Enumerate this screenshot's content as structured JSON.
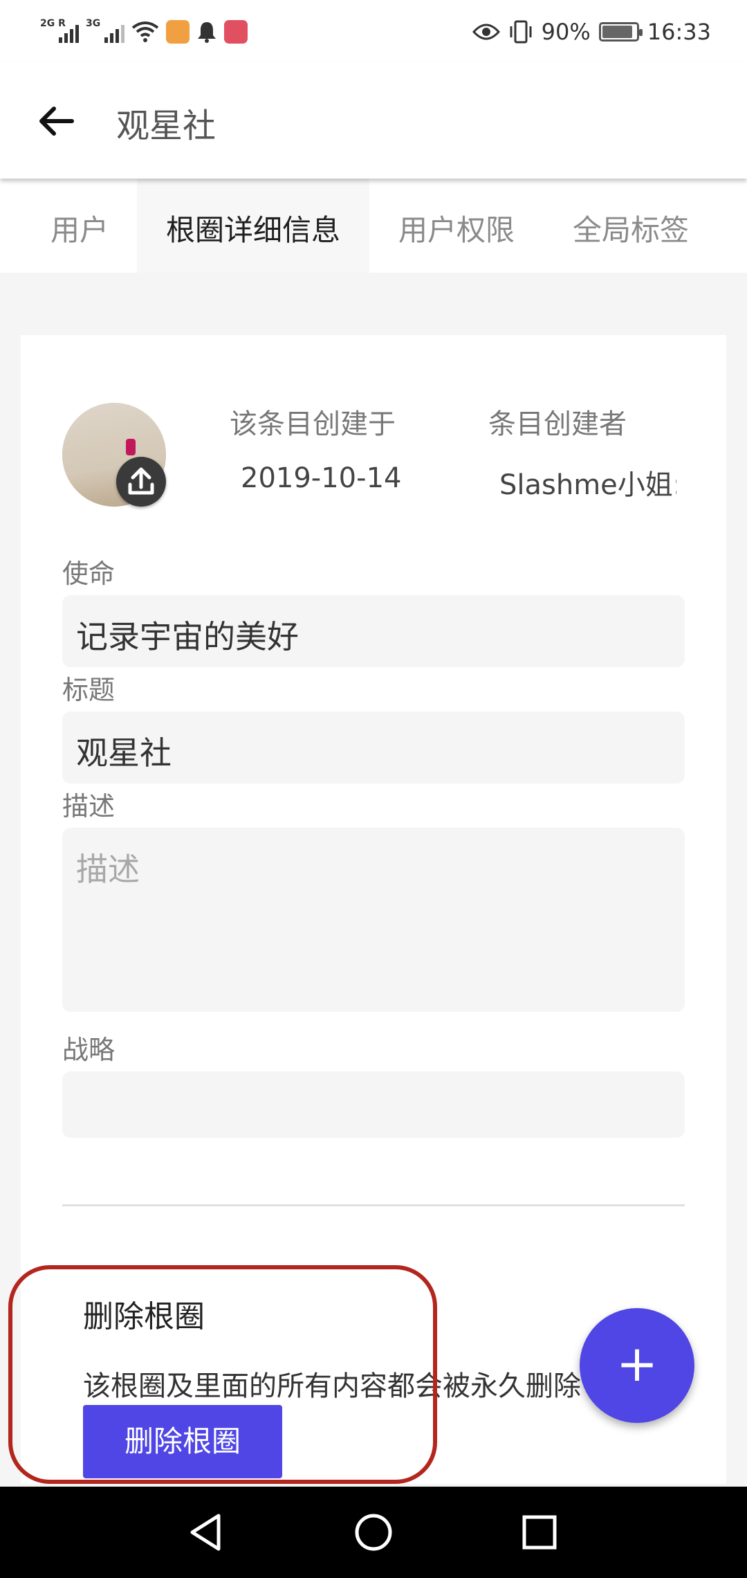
{
  "status_bar": {
    "signal1_tag": "2G R",
    "signal2_tag": "3G",
    "battery_percent": "90%",
    "battery_level": 0.9,
    "time": "16:33",
    "icons": [
      "signal-icon",
      "signal-icon",
      "wifi-icon",
      "app-notification-icon",
      "bell-icon",
      "app-notification-icon",
      "eye-icon",
      "vibrate-icon",
      "battery-icon"
    ]
  },
  "app_bar": {
    "title": "观星社",
    "back_icon": "arrow-back-icon"
  },
  "tabs": [
    {
      "label": "用户",
      "active": false
    },
    {
      "label": "根圈详细信息",
      "active": true
    },
    {
      "label": "用户权限",
      "active": false
    },
    {
      "label": "全局标签",
      "active": false
    }
  ],
  "details": {
    "created_label": "该条目创建于",
    "created_value": "2019-10-14",
    "creator_label": "条目创建者",
    "creator_value": "Slashme小姐:",
    "upload_icon": "upload-icon"
  },
  "form": {
    "mission_label": "使命",
    "mission_value": "记录宇宙的美好",
    "title_label": "标题",
    "title_value": "观星社",
    "description_label": "描述",
    "description_placeholder": "描述",
    "strategy_label": "战略",
    "strategy_value": ""
  },
  "danger_zone": {
    "title": "删除根圈",
    "description": "该根圈及里面的所有内容都会被永久删除",
    "button_label": "删除根圈"
  },
  "fab": {
    "icon": "plus-icon",
    "label": "+"
  },
  "colors": {
    "accent": "#4f46e5",
    "annotation": "#b3261e"
  },
  "nav_bar": {
    "icons": [
      "nav-back-icon",
      "nav-home-icon",
      "nav-recents-icon"
    ]
  }
}
